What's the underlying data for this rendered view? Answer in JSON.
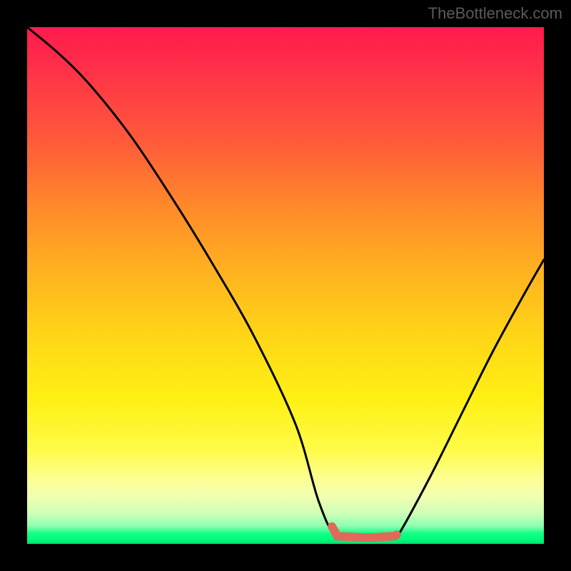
{
  "watermark": "TheBottleneck.com",
  "chart_data": {
    "type": "line",
    "title": "",
    "xlabel": "",
    "ylabel": "",
    "xlim": [
      0,
      100
    ],
    "ylim": [
      0,
      100
    ],
    "series": [
      {
        "name": "bottleneck-curve",
        "x": [
          0,
          6,
          12,
          20,
          28,
          36,
          44,
          52,
          56.5,
          60,
          66,
          71,
          72,
          78,
          84,
          90,
          96,
          100
        ],
        "values": [
          100,
          95,
          89,
          79,
          67,
          54,
          40,
          23,
          8,
          1.5,
          1.2,
          1.5,
          2,
          13,
          25,
          37,
          48,
          55
        ]
      }
    ],
    "flat_region_x": [
      59,
      71.5
    ],
    "marker_color": "#e06a5a",
    "curve_color": "#000000",
    "gradient_stops": [
      {
        "pos": 0,
        "color": "#ff1a4d"
      },
      {
        "pos": 0.35,
        "color": "#ff8a2a"
      },
      {
        "pos": 0.72,
        "color": "#fff014"
      },
      {
        "pos": 0.985,
        "color": "#00ff7a"
      },
      {
        "pos": 1.0,
        "color": "#00e070"
      }
    ]
  }
}
